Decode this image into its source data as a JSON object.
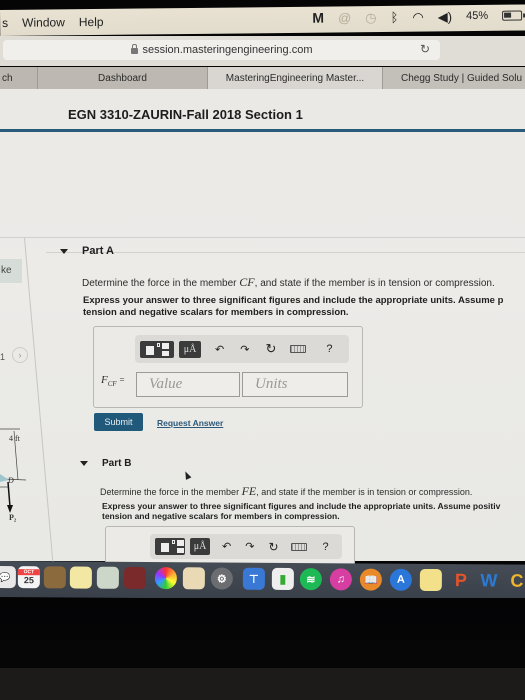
{
  "menubar": {
    "items": [
      "s",
      "Window",
      "Help"
    ],
    "status_icons": [
      "malwarebytes-icon",
      "creative-cloud-icon",
      "time-machine-icon",
      "bluetooth-icon",
      "wifi-icon",
      "volume-icon"
    ],
    "battery_percent": "45%"
  },
  "browser": {
    "url": "session.masteringengineering.com",
    "tabs": [
      {
        "label": "ch",
        "active": false
      },
      {
        "label": "Dashboard",
        "active": false
      },
      {
        "label": "MasteringEngineering Master...",
        "active": true
      },
      {
        "label": "Chegg Study | Guided Solu",
        "active": false
      }
    ]
  },
  "page": {
    "course_title": "EGN 3310-ZAURIN-Fall 2018 Section 1",
    "left_tab_label": "ke",
    "pager_number": "1",
    "pager_next": "›",
    "diagram": {
      "dimension_label": "4 ft",
      "node_label": "D",
      "force_label": "P₂"
    },
    "parts": [
      {
        "title": "Part A",
        "question_prefix": "Determine the force in the member",
        "member": "CF",
        "question_suffix": ", and state if the member is in tension or compression.",
        "instruction_line1": "Express your answer to three significant figures and include the appropriate units. Assume p",
        "instruction_line2": "tension and negative scalars for members in compression.",
        "var_name": "F",
        "var_sub": "CF",
        "equals": "=",
        "value_placeholder": "Value",
        "units_placeholder": "Units",
        "submit_label": "Submit",
        "request_label": "Request Answer"
      },
      {
        "title": "Part B",
        "question_prefix": "Determine the force in the member",
        "member": "FE",
        "question_suffix": ", and state if the member is in tension or compression.",
        "instruction_line1": "Express your answer to three significant figures and include the appropriate units. Assume positiv",
        "instruction_line2": "tension and negative scalars for members in compression."
      }
    ],
    "toolbar": {
      "units_label": "μÅ",
      "undo": "↶",
      "redo": "↷",
      "reset": "↻",
      "help": "?"
    }
  },
  "dock": {
    "calendar_month": "OCT",
    "calendar_day": "25",
    "apps": [
      "messages",
      "calendar",
      "contacts",
      "notes",
      "preview",
      "photo-booth",
      "photos",
      "pages",
      "system-preferences",
      "keynote",
      "numbers",
      "spotify",
      "itunes",
      "ibooks",
      "app-store",
      "stickies",
      "powerpoint",
      "word",
      "other"
    ]
  }
}
